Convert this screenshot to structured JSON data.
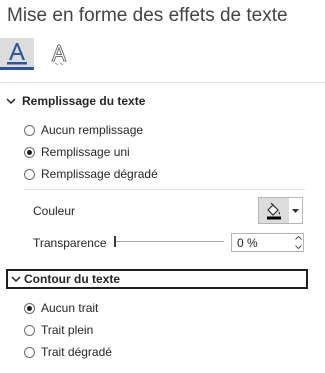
{
  "pane": {
    "title": "Mise en forme des effets de texte"
  },
  "tabs": [
    {
      "id": "text-fill-outline",
      "icon": "text-fill-outline-icon",
      "selected": true,
      "accent": "#2b579a"
    },
    {
      "id": "text-effects",
      "icon": "text-effects-icon",
      "selected": false
    }
  ],
  "fill_section": {
    "header": "Remplissage du texte",
    "expanded": true,
    "options": [
      {
        "label": "Aucun remplissage",
        "checked": false
      },
      {
        "label": "Remplissage uni",
        "checked": true
      },
      {
        "label": "Remplissage dégradé",
        "checked": false
      }
    ],
    "color_label": "Couleur",
    "color_button_icon": "paint-bucket-icon",
    "transparency_label": "Transparence",
    "transparency_fraction": 0,
    "transparency_value": "0 %"
  },
  "outline_section": {
    "header": "Contour du texte",
    "expanded": true,
    "options": [
      {
        "label": "Aucun trait",
        "checked": true
      },
      {
        "label": "Trait plein",
        "checked": false
      },
      {
        "label": "Trait dégradé",
        "checked": false
      }
    ]
  }
}
